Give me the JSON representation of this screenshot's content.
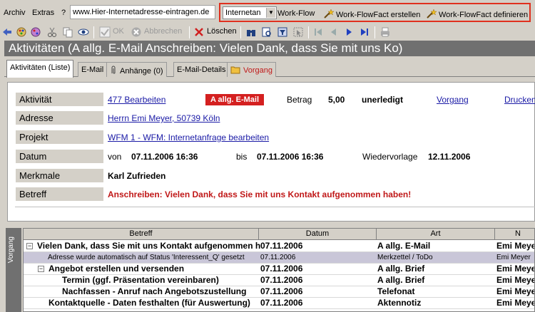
{
  "menu": {
    "items": [
      "Archiv",
      "Extras",
      "?"
    ],
    "url": "www.Hier-Internetadresse-eintragen.de"
  },
  "redbar": {
    "combo": "Internetan",
    "workflow": "Work-Flow",
    "wff_create": "Work-FlowFact erstellen",
    "wff_define": "Work-FlowFact definieren"
  },
  "toolbar": {
    "ok": "OK",
    "cancel": "Abbrechen",
    "delete": "Löschen"
  },
  "title": "Aktivitäten (A allg. E-Mail Anschreiben: Vielen Dank, dass Sie mit uns Ko)",
  "tabs": [
    "Aktivitäten (Liste)",
    "E-Mail",
    "Anhänge (0)",
    "E-Mail-Details",
    "Vorgang"
  ],
  "form": {
    "labels": {
      "aktivitaet": "Aktivität",
      "adresse": "Adresse",
      "projekt": "Projekt",
      "datum": "Datum",
      "merkmale": "Merkmale",
      "betreff": "Betreff"
    },
    "aktivitaet_link": "477  Bearbeiten",
    "badge": "A allg. E-Mail",
    "betrag_label": "Betrag",
    "betrag": "5,00",
    "status": "unerledigt",
    "vorgang_link": "Vorgang",
    "drucken_link": "Drucken",
    "adresse": "Herrn Emi Meyer,  50739 Köln",
    "projekt": "WFM 1 - WFM: Internetanfrage bearbeiten",
    "von_label": "von",
    "von": "07.11.2006 16:36",
    "bis_label": "bis",
    "bis": "07.11.2006 16:36",
    "wiedervorlage_label": "Wiedervorlage",
    "wiedervorlage": "12.11.2006",
    "merkmale": "Karl Zufrieden",
    "betreff": "Anschreiben: Vielen Dank, dass Sie mit uns Kontakt aufgenommen haben!"
  },
  "sidetab": "Vorgang",
  "grid": {
    "headers": [
      "Betreff",
      "Datum",
      "Art",
      "N"
    ],
    "rows": [
      {
        "betreff": "Vielen Dank, dass Sie mit uns Kontakt aufgenommen h",
        "datum": "07.11.2006",
        "art": "A allg. E-Mail",
        "name": "Emi Meyer"
      },
      {
        "betreff": "Adresse wurde automatisch auf Status 'Interessent_Q' gesetzt",
        "datum": "07.11.2006",
        "art": "Merkzettel / ToDo",
        "name": "Emi Meyer"
      },
      {
        "betreff": "Angebot erstellen und versenden",
        "datum": "07.11.2006",
        "art": "A allg. Brief",
        "name": "Emi Meye"
      },
      {
        "betreff": "Termin (ggf. Präsentation vereinbaren)",
        "datum": "07.11.2006",
        "art": "A allg. Brief",
        "name": "Emi Meye"
      },
      {
        "betreff": "Nachfassen - Anruf nach Angebotszustellung",
        "datum": "07.11.2006",
        "art": "Telefonat",
        "name": "Emi Meye"
      },
      {
        "betreff": "Kontaktquelle - Daten festhalten (für Auswertung)",
        "datum": "07.11.2006",
        "art": "Aktennotiz",
        "name": "Emi Meye"
      }
    ]
  }
}
